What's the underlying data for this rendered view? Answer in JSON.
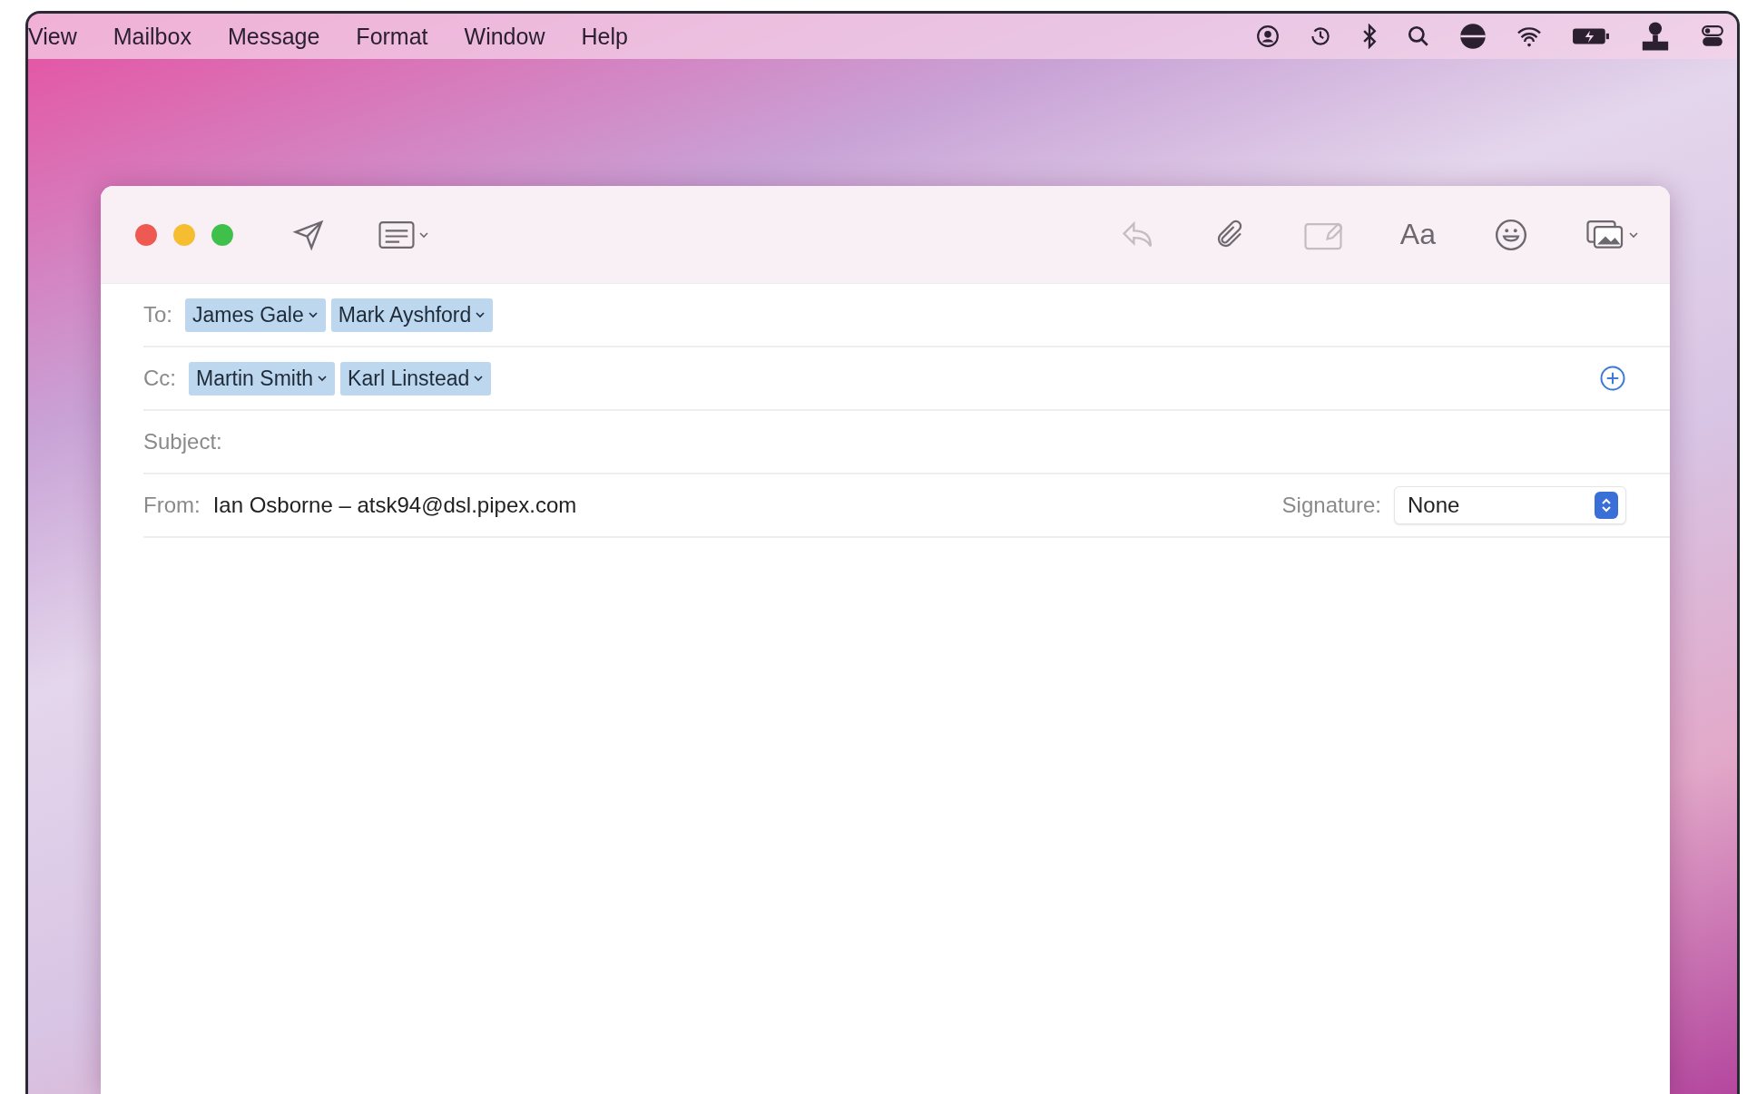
{
  "menu_bar": {
    "items": [
      "View",
      "Mailbox",
      "Message",
      "Format",
      "Window",
      "Help"
    ]
  },
  "toolbar": {
    "items": [
      {
        "kind": "send",
        "disabled": false
      },
      {
        "kind": "header",
        "disabled": false
      },
      {
        "kind": "reply",
        "disabled": true
      },
      {
        "kind": "attach",
        "disabled": false
      },
      {
        "kind": "markup",
        "disabled": true
      },
      {
        "kind": "format",
        "label": "Aa",
        "disabled": false
      },
      {
        "kind": "emoji",
        "disabled": false
      },
      {
        "kind": "photo",
        "disabled": false
      }
    ]
  },
  "fields": [
    {
      "kind": "recipients",
      "label": "To:",
      "tokens": [
        "James Gale",
        "Mark Ayshford"
      ]
    },
    {
      "kind": "recipients",
      "label": "Cc:",
      "tokens": [
        "Martin Smith",
        "Karl Linstead"
      ],
      "add_button": true
    },
    {
      "kind": "text",
      "label": "Subject:"
    },
    {
      "kind": "from",
      "label": "From:",
      "value": "Ian Osborne – atsk94@dsl.pipex.com",
      "signature_label": "Signature:",
      "signature_value": "None"
    }
  ]
}
